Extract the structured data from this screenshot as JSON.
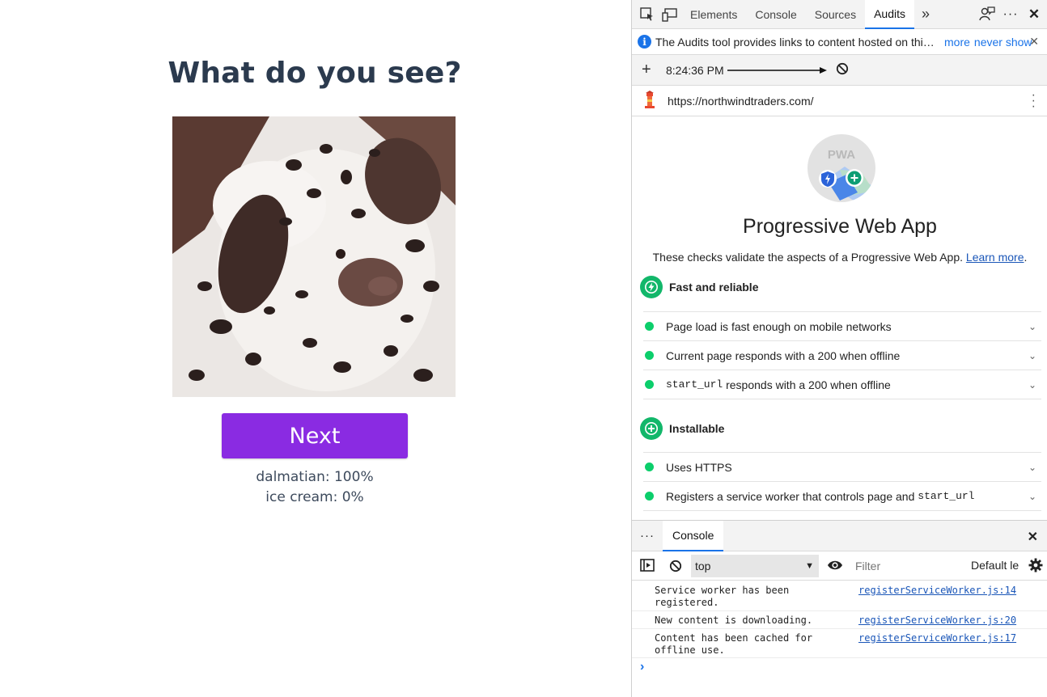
{
  "app": {
    "title": "What do you see?",
    "image_alt": "dalmatian puppy photo",
    "next_label": "Next",
    "predictions": [
      "dalmatian: 100%",
      "ice cream: 0%"
    ]
  },
  "devtools": {
    "tabs": [
      "Elements",
      "Console",
      "Sources",
      "Audits"
    ],
    "active_tab": "Audits",
    "more_tabs_icon": "chevrons-right-icon",
    "infobar": {
      "text": "The Audits tool provides links to content hosted on thi…",
      "more": "more",
      "never_show": "never show"
    },
    "run": {
      "time": "8:24:36 PM"
    },
    "url": "https://northwindtraders.com/",
    "pwa": {
      "badge_text": "PWA",
      "title": "Progressive Web App",
      "description": "These checks validate the aspects of a Progressive Web App.",
      "learn_more": "Learn more",
      "learn_more_suffix": ".",
      "groups": [
        {
          "name": "Fast and reliable",
          "audits": [
            {
              "label": "Page load is fast enough on mobile networks"
            },
            {
              "label": "Current page responds with a 200 when offline"
            },
            {
              "code": "start_url",
              "label": " responds with a 200 when offline"
            }
          ]
        },
        {
          "name": "Installable",
          "audits": [
            {
              "label": "Uses HTTPS"
            },
            {
              "label": "Registers a service worker that controls page and ",
              "code": "start_url"
            }
          ]
        }
      ]
    },
    "console": {
      "tab": "Console",
      "context": "top",
      "filter_placeholder": "Filter",
      "levels": "Default le",
      "messages": [
        {
          "text": "Service worker has been registered.",
          "source": "registerServiceWorker.js:14"
        },
        {
          "text": "New content is downloading.",
          "source": "registerServiceWorker.js:20"
        },
        {
          "text": "Content has been cached for offline use.",
          "source": "registerServiceWorker.js:17"
        }
      ],
      "prompt": "›"
    },
    "colors": {
      "accent": "#1a73e8",
      "pass": "#0cce6b",
      "button": "#8a2be2"
    }
  }
}
